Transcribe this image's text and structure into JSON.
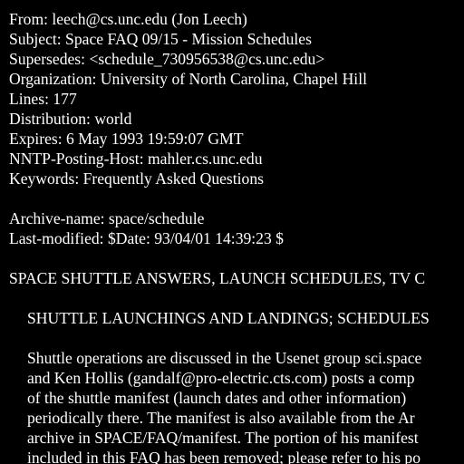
{
  "colors": {
    "background": "#000000",
    "text": "#ffffff"
  },
  "header": {
    "from": "From: leech@cs.unc.edu (Jon Leech)",
    "subject": "Subject: Space FAQ 09/15 - Mission Schedules",
    "supersedes": "Supersedes: <schedule_730956538@cs.unc.edu>",
    "organization": "Organization: University of North Carolina, Chapel Hill",
    "lines": "Lines: 177",
    "distribution": "Distribution: world",
    "expires": "Expires: 6 May 1993 19:59:07 GMT",
    "nntp_posting_host": "NNTP-Posting-Host: mahler.cs.unc.edu",
    "keywords": "Keywords: Frequently Asked Questions"
  },
  "archive": {
    "name": "Archive-name: space/schedule",
    "last_modified": "Last-modified: $Date: 93/04/01 14:39:23 $"
  },
  "body": {
    "title": "SPACE SHUTTLE ANSWERS, LAUNCH SCHEDULES, TV C",
    "section_heading": "SHUTTLE LAUNCHINGS AND LANDINGS; SCHEDULES",
    "paragraph_lines": [
      "Shuttle operations are discussed in the Usenet group sci.space",
      "and Ken Hollis (gandalf@pro-electric.cts.com) posts a comp",
      "of the shuttle manifest (launch dates and other information)",
      "periodically there. The manifest is also available from the Ar",
      "archive in SPACE/FAQ/manifest. The portion of his manifest",
      "included in this FAQ has been removed; please refer to his po"
    ]
  }
}
